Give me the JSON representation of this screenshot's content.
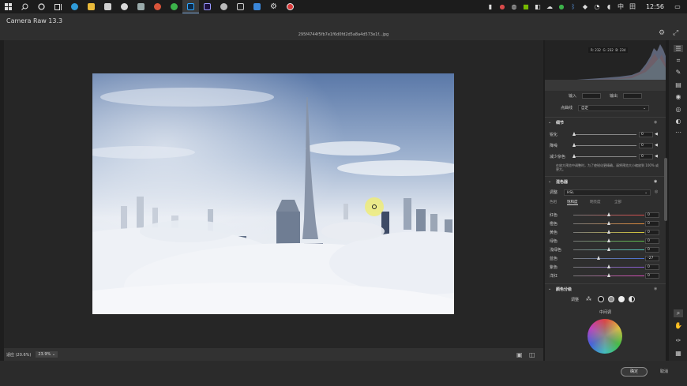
{
  "taskbar": {
    "clock": "12:56",
    "tray_ime": "中",
    "tray_grid": "田"
  },
  "app": {
    "title": "Camera Raw 13.3",
    "filename": "295f4744f5fb7e1f6d0fd2d5a8a4d573e1f...jpg"
  },
  "histogram": {
    "r_label": "R: 232",
    "g_label": "G: 232",
    "b_label": "B: 234"
  },
  "curve": {
    "input_label": "输入",
    "output_label": "输出",
    "point_curve_label": "点曲线",
    "point_curve_value": "自定"
  },
  "detail": {
    "title": "细节",
    "rows": [
      {
        "label": "锐化",
        "value": "0",
        "pos": 0.02
      },
      {
        "label": "降噪",
        "value": "0",
        "pos": 0.02
      },
      {
        "label": "减少杂色",
        "value": "0",
        "pos": 0.02
      }
    ],
    "note": "在放大预览中调整时，为了使锐化更精确，请将预览大小缩放到 100% 或更大。"
  },
  "mixer": {
    "title": "混色器",
    "adjust_label": "调整",
    "adjust_value": "HSL",
    "tabs": [
      "色相",
      "饱和度",
      "明亮度",
      "全部"
    ],
    "active_tab": 1,
    "rows": [
      {
        "label": "红色",
        "value": "0",
        "pos": 0.5,
        "color": "#d94b4b"
      },
      {
        "label": "橙色",
        "value": "0",
        "pos": 0.5,
        "color": "#e08a3a"
      },
      {
        "label": "黄色",
        "value": "0",
        "pos": 0.5,
        "color": "#d8c93a"
      },
      {
        "label": "绿色",
        "value": "0",
        "pos": 0.5,
        "color": "#5cbf4a"
      },
      {
        "label": "浅绿色",
        "value": "0",
        "pos": 0.5,
        "color": "#4ec8b8"
      },
      {
        "label": "蓝色",
        "value": "-27",
        "pos": 0.365,
        "color": "#4a72d8"
      },
      {
        "label": "紫色",
        "value": "0",
        "pos": 0.5,
        "color": "#8a5ad8"
      },
      {
        "label": "洋红",
        "value": "0",
        "pos": 0.5,
        "color": "#d84ab8"
      }
    ]
  },
  "grading": {
    "title": "颜色分级",
    "adjust_label": "调整",
    "midtones_label": "中间调"
  },
  "status": {
    "left_label": "适应 (20.6%)",
    "zoom": "23.9%"
  },
  "buttons": {
    "ok": "确定",
    "cancel": "取消"
  },
  "colors": {
    "accent": "#7aa7d8",
    "panel_bg": "#2e2e2e",
    "sky_top": "#5a78a8",
    "cloud": "#eef1f6"
  }
}
